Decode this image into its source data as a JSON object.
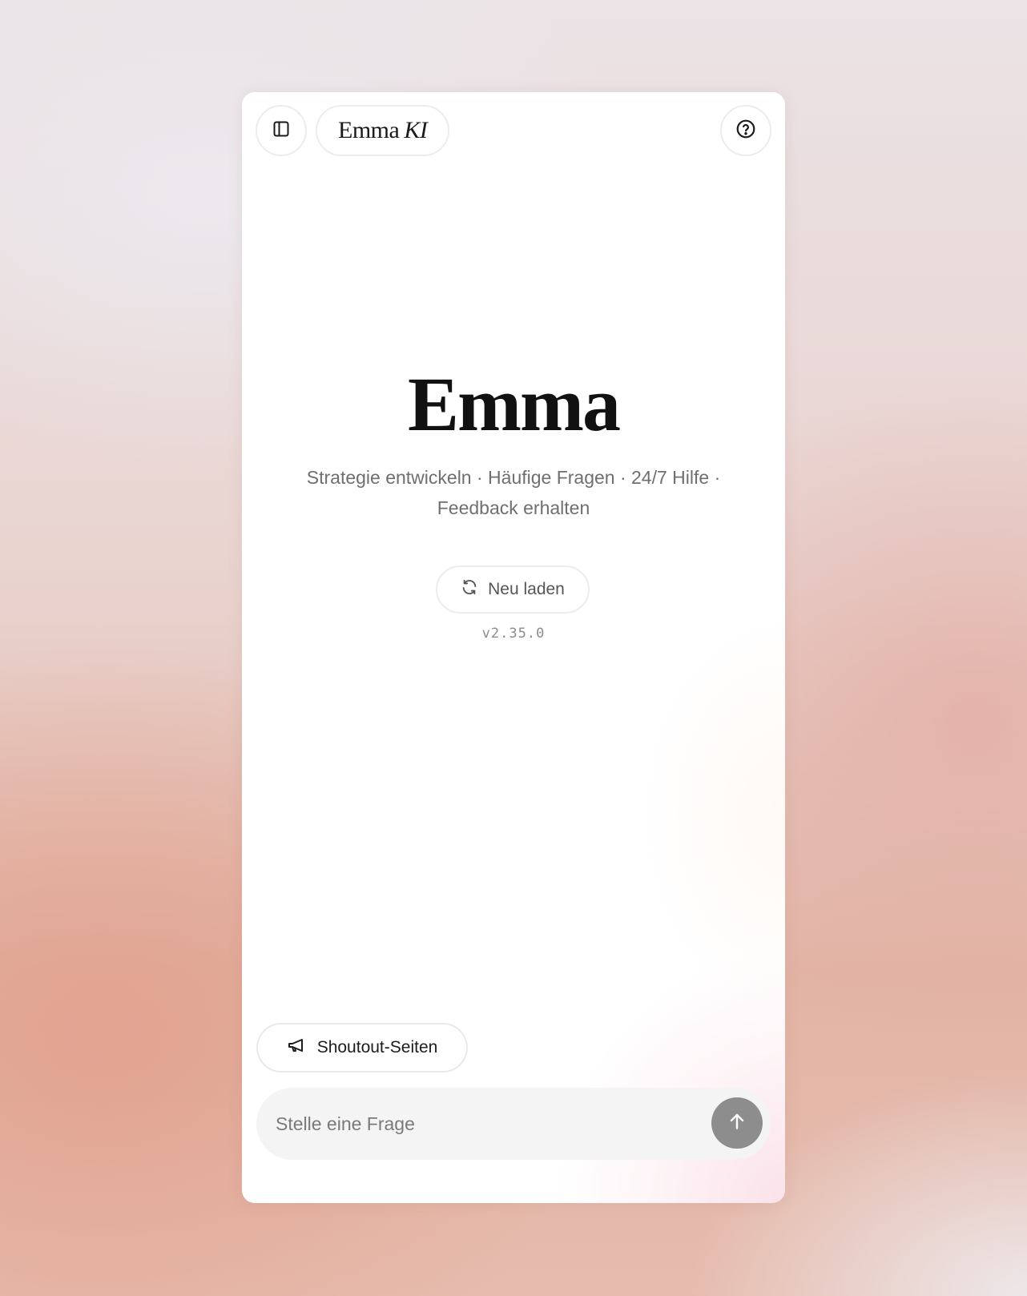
{
  "header": {
    "brand_name": "Emma",
    "brand_suffix": "KI",
    "sidebar_icon": "sidebar-toggle-icon",
    "help_icon": "help-circle-icon"
  },
  "hero": {
    "title": "Emma",
    "subtitle": "Strategie entwickeln · Häufige Fragen · 24/7 Hilfe · Feedback erhalten"
  },
  "reload": {
    "label": "Neu laden",
    "icon": "refresh-icon"
  },
  "version": "v2.35.0",
  "shoutout": {
    "label": "Shoutout-Seiten",
    "icon": "megaphone-icon"
  },
  "composer": {
    "placeholder": "Stelle eine Frage",
    "value": "",
    "send_icon": "arrow-up-icon"
  },
  "colors": {
    "send_button": "#8d8d8d",
    "text_primary": "#111111",
    "text_secondary": "#6f6f6f"
  }
}
